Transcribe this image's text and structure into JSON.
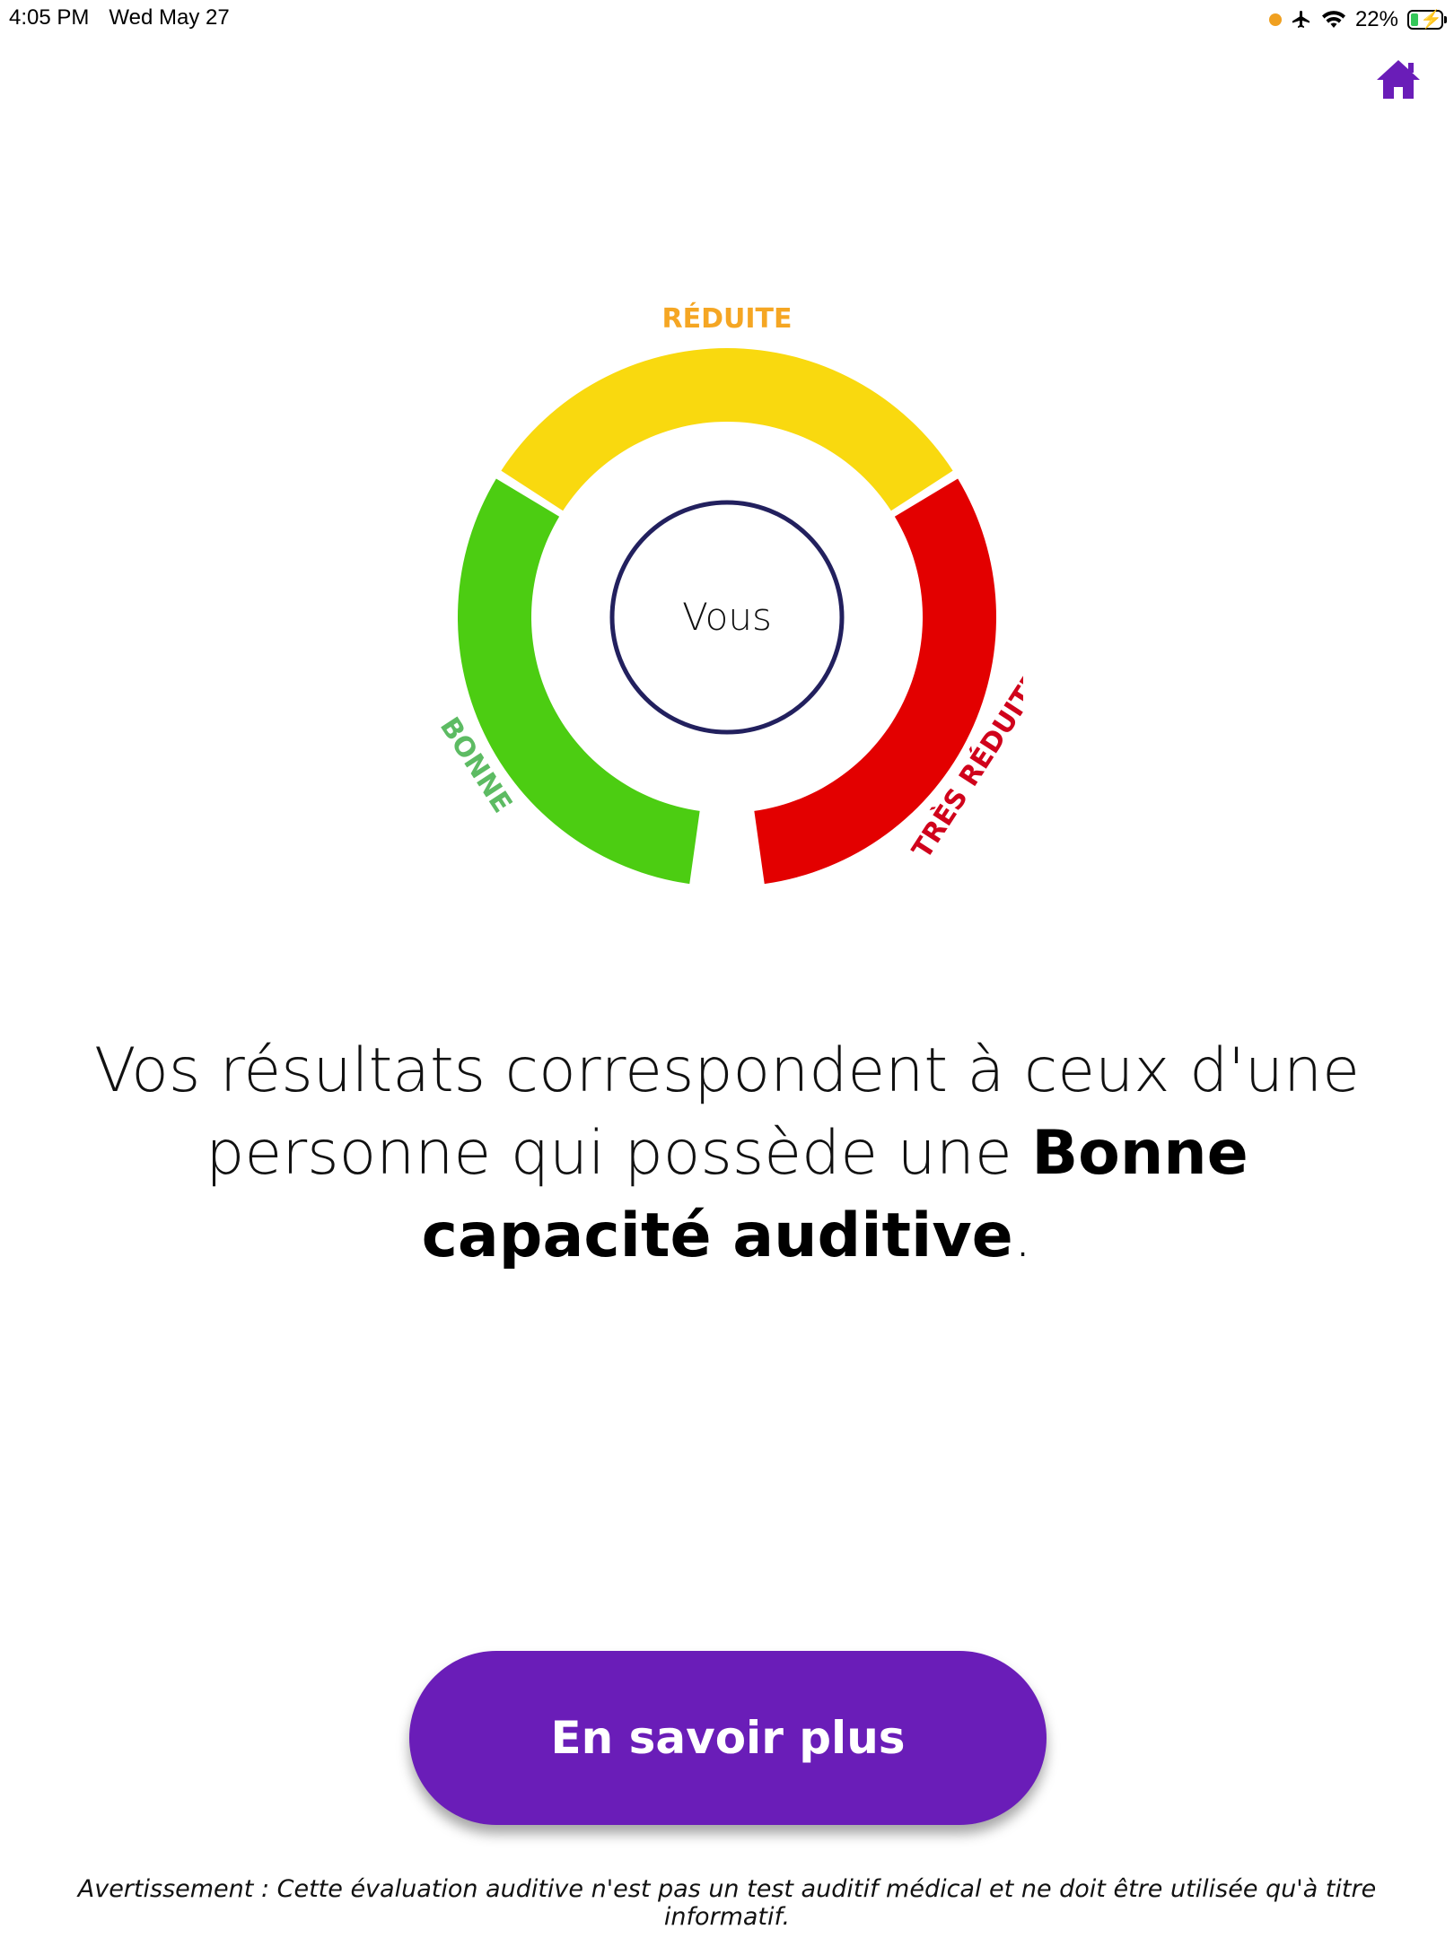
{
  "status_bar": {
    "time": "4:05 PM",
    "date": "Wed May 27",
    "battery": "22%",
    "icons": [
      "orange-dot-icon",
      "airplane-icon",
      "wifi-icon",
      "battery-charging-icon"
    ]
  },
  "nav": {
    "home_icon": "home-icon",
    "accent_color": "#6a1db8"
  },
  "gauge": {
    "labels": {
      "good": "BONNE",
      "reduced": "RÉDUITE",
      "very_reduced": "TRÈS RÉDUITE"
    },
    "colors": {
      "good": "#4ccd12",
      "reduced": "#f9d90f",
      "very_reduced": "#e30000",
      "good_label": "#5dbb63",
      "reduced_label": "#f5a623",
      "very_reduced_label": "#d0021b",
      "pointer": "#22205e"
    },
    "pointer_label": "Vous",
    "pointer_zone": "good"
  },
  "result": {
    "prefix": "Vos résultats correspondent à ceux d'une personne qui possède une ",
    "emphasis": "Bonne capacité auditive",
    "suffix": "."
  },
  "cta": {
    "label": "En savoir plus"
  },
  "disclaimer": "Avertissement : Cette évaluation auditive n'est pas un test auditif médical et ne doit être utilisée qu'à titre informatif."
}
